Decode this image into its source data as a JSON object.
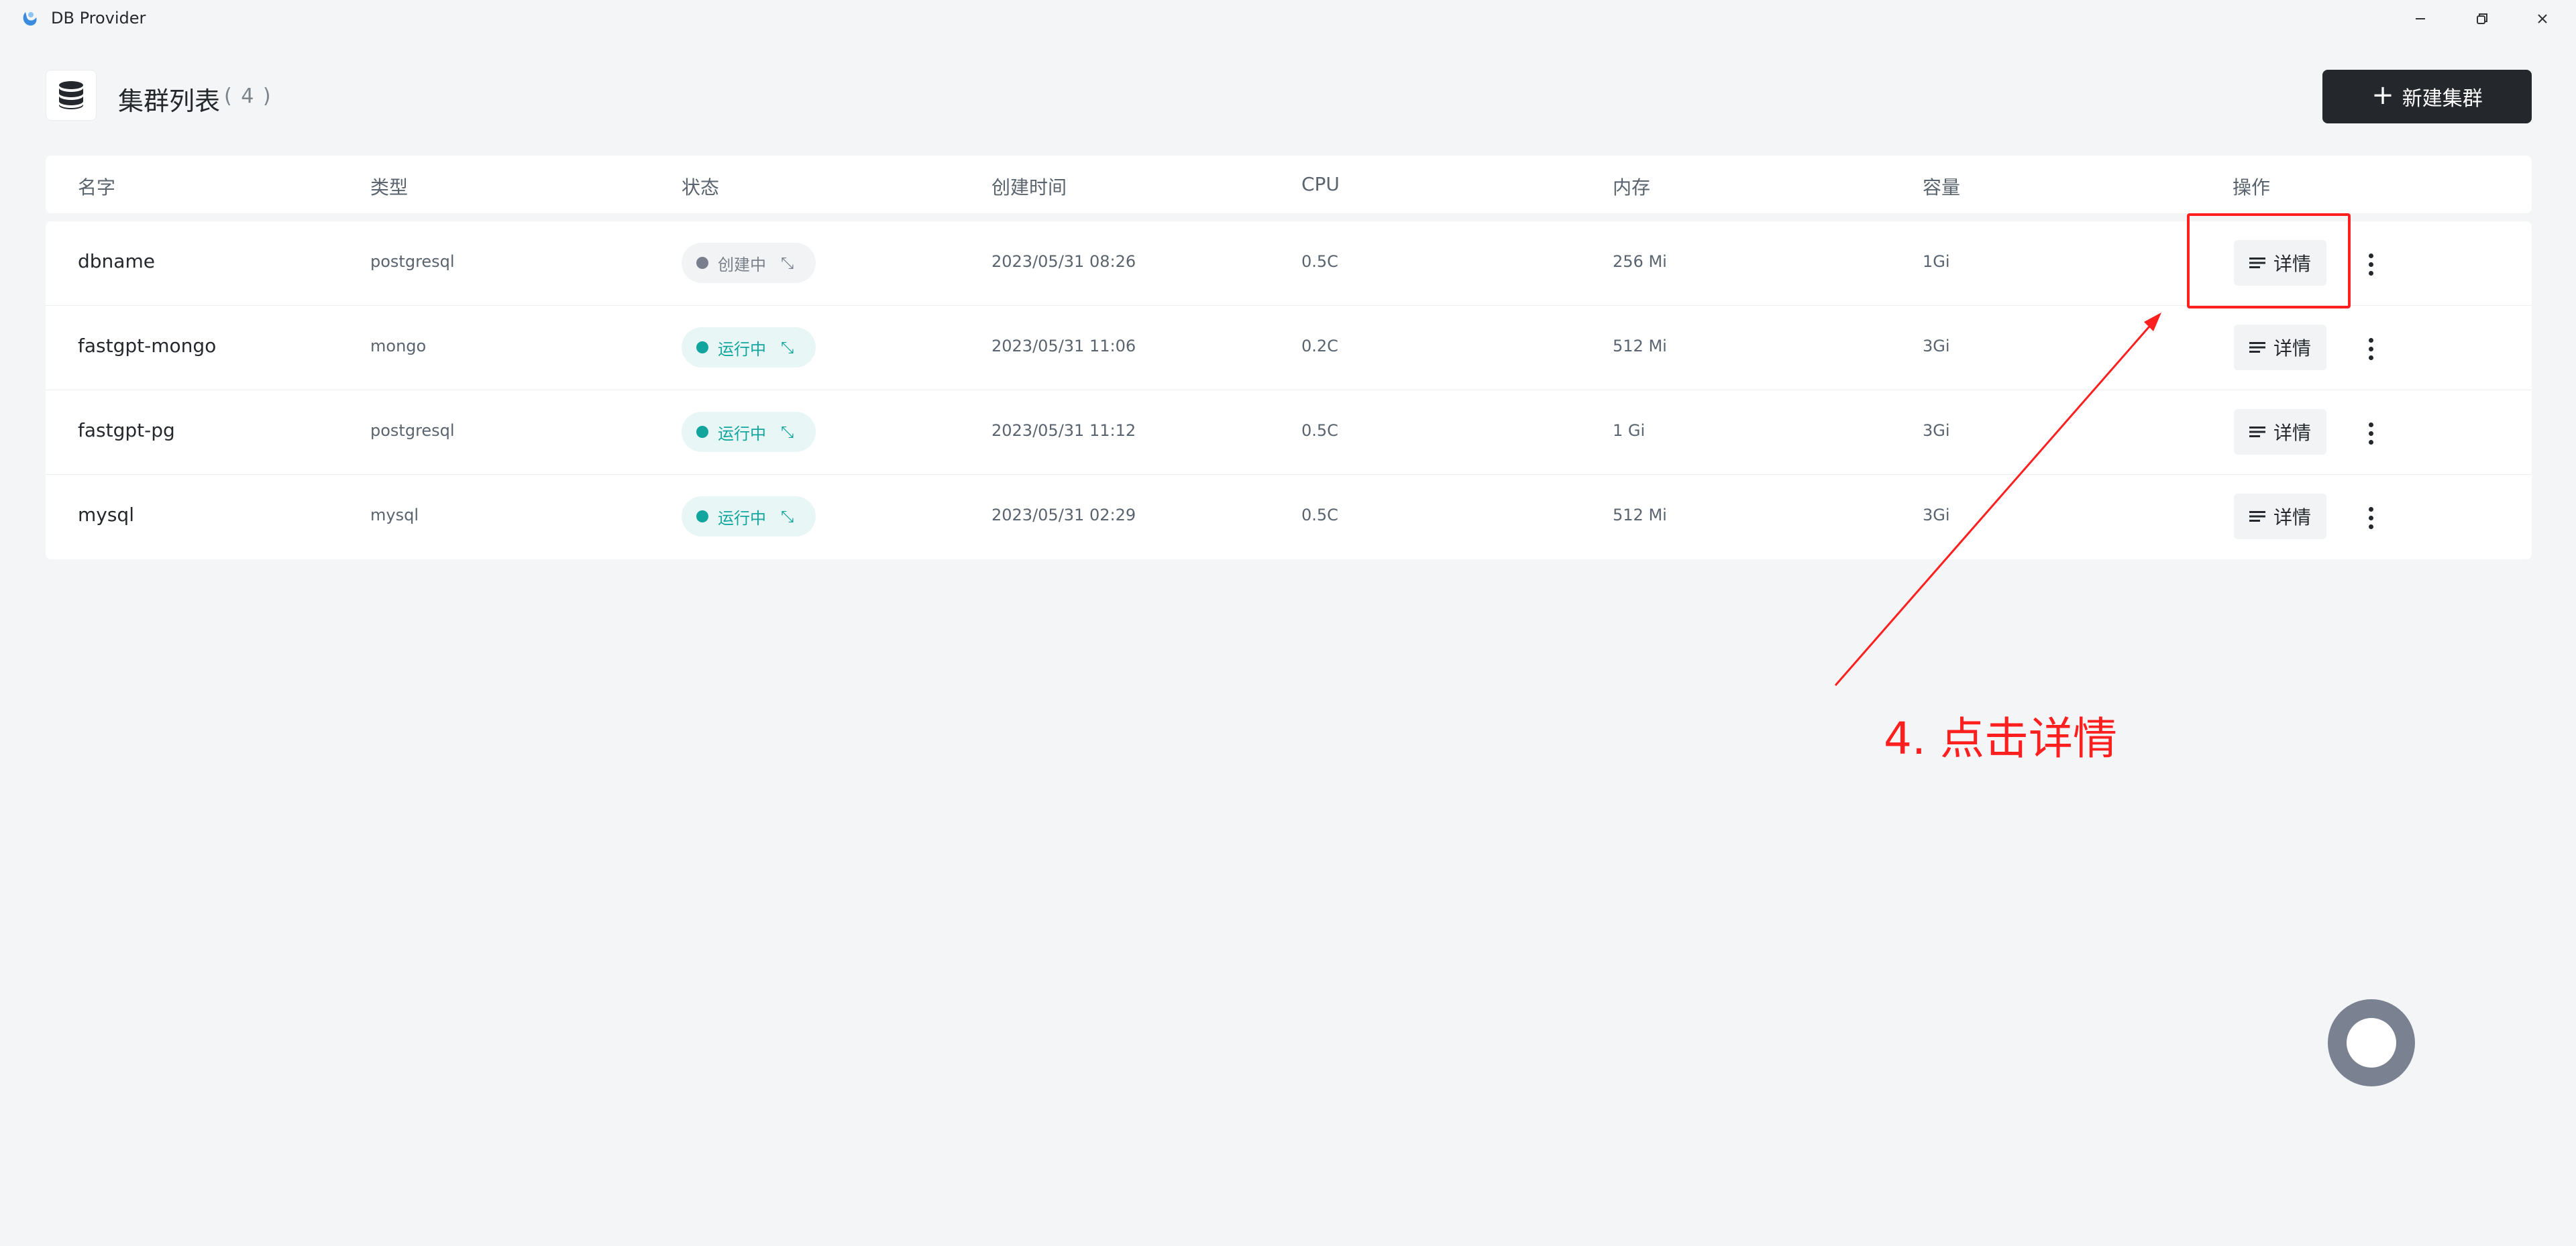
{
  "window": {
    "title": "DB Provider"
  },
  "header": {
    "title": "集群列表",
    "count": "( 4 )",
    "new_button_label": "新建集群",
    "new_button_icon": "+"
  },
  "table": {
    "columns": [
      "名字",
      "类型",
      "状态",
      "创建时间",
      "CPU",
      "内存",
      "容量",
      "操作"
    ],
    "rows": [
      {
        "name": "dbname",
        "type": "postgresql",
        "status": "创建中",
        "status_kind": "creating",
        "created": "2023/05/31 08:26",
        "cpu": "0.5C",
        "memory": "256 Mi",
        "storage": "1Gi",
        "action": "详情"
      },
      {
        "name": "fastgpt-mongo",
        "type": "mongo",
        "status": "运行中",
        "status_kind": "running",
        "created": "2023/05/31 11:06",
        "cpu": "0.2C",
        "memory": "512 Mi",
        "storage": "3Gi",
        "action": "详情"
      },
      {
        "name": "fastgpt-pg",
        "type": "postgresql",
        "status": "运行中",
        "status_kind": "running",
        "created": "2023/05/31 11:12",
        "cpu": "0.5C",
        "memory": "1 Gi",
        "storage": "3Gi",
        "action": "详情"
      },
      {
        "name": "mysql",
        "type": "mysql",
        "status": "运行中",
        "status_kind": "running",
        "created": "2023/05/31 02:29",
        "cpu": "0.5C",
        "memory": "512 Mi",
        "storage": "3Gi",
        "action": "详情"
      }
    ]
  },
  "annotation": {
    "text": "4. 点击详情",
    "color": "#ff1f1f"
  },
  "colors": {
    "running": "#11a59e",
    "creating": "#7a7f8e",
    "primary_button": "#24282c",
    "background": "#f4f5f7"
  },
  "icons": {
    "app": "app-logo-icon",
    "header": "database-icon",
    "status_spin": "loading-arrows-icon",
    "detail": "list-lines-icon",
    "more": "vertical-dots-icon"
  }
}
